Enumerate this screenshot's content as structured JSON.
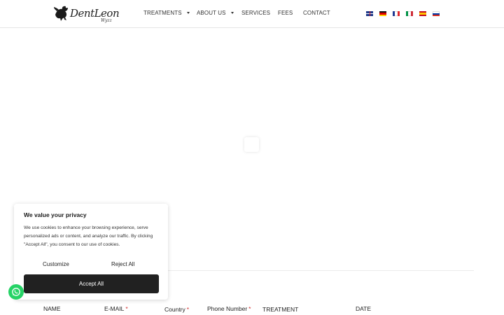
{
  "header": {
    "logo": {
      "text": "DentLeon",
      "sub": "Wyzz"
    },
    "nav": [
      {
        "label": "TREATMENTS",
        "has_dropdown": true
      },
      {
        "label": "ABOUT US",
        "has_dropdown": true
      },
      {
        "label": "SERVICES",
        "has_dropdown": false
      },
      {
        "label": "FEES",
        "has_dropdown": false
      },
      {
        "label": "CONTACT",
        "has_dropdown": false
      }
    ],
    "languages": [
      {
        "icon": "flag-uk-icon"
      },
      {
        "icon": "flag-germany-icon"
      },
      {
        "icon": "flag-france-icon"
      },
      {
        "icon": "flag-italy-icon"
      },
      {
        "icon": "flag-spain-icon"
      },
      {
        "icon": "flag-russia-icon"
      }
    ]
  },
  "form": {
    "labels": [
      {
        "text": "NAME",
        "required": false
      },
      {
        "text": "E-MAIL",
        "required": true
      },
      {
        "text": "Country",
        "required": true
      },
      {
        "text": "Phone Number",
        "required": true
      },
      {
        "text": "TREATMENT",
        "required": false
      },
      {
        "text": "DATE",
        "required": false
      }
    ],
    "required_marker": "*"
  },
  "cookie_banner": {
    "title": "We value your privacy",
    "body": "We use cookies to enhance your browsing experience, serve personalized ads or content, and analyze our traffic. By clicking \"Accept All\", you consent to our use of cookies.",
    "customize_label": "Customize",
    "reject_label": "Reject All",
    "accept_label": "Accept All"
  },
  "whatsapp": {
    "icon": "whatsapp-icon"
  },
  "colors": {
    "accent_dark": "#212121",
    "required": "#d32f2f",
    "whatsapp": "#25d366"
  }
}
